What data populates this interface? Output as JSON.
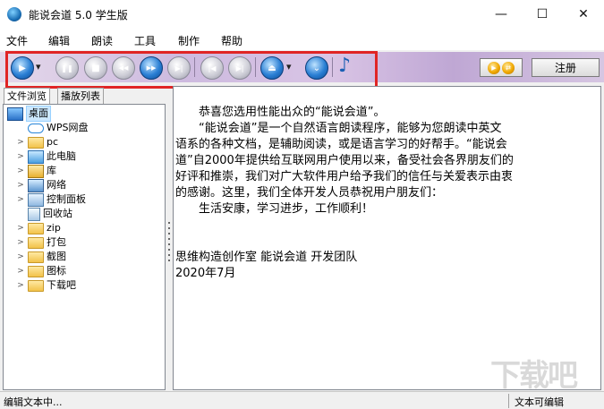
{
  "window": {
    "title": "能说会道 5.0 学生版",
    "minimize_glyph": "—",
    "maximize_glyph": "☐",
    "close_glyph": "✕"
  },
  "menu": [
    "文件",
    "编辑",
    "朗读",
    "工具",
    "制作",
    "帮助"
  ],
  "toolbar": {
    "buttons": [
      {
        "name": "play",
        "icon": "play-icon",
        "glyph": "▶"
      },
      {
        "name": "play-dropdown",
        "icon": "dropdown-arrow-icon",
        "glyph": "▾"
      },
      {
        "name": "pause",
        "icon": "pause-icon",
        "glyph": "❚❚"
      },
      {
        "name": "stop",
        "icon": "stop-icon",
        "glyph": "■"
      },
      {
        "name": "rewind",
        "icon": "rewind-icon",
        "glyph": "◀◀"
      },
      {
        "name": "fast-forward",
        "icon": "fast-forward-icon",
        "glyph": "▶▶"
      },
      {
        "name": "skip-end",
        "icon": "skip-end-icon",
        "glyph": "▶|"
      },
      {
        "name": "prev-track",
        "icon": "prev-track-icon",
        "glyph": "|◀"
      },
      {
        "name": "next-track",
        "icon": "next-track-icon",
        "glyph": "▶|"
      },
      {
        "name": "eject",
        "icon": "eject-icon",
        "glyph": "⏏"
      },
      {
        "name": "eject-dropdown",
        "icon": "dropdown-arrow-icon",
        "glyph": "▾"
      },
      {
        "name": "down",
        "icon": "chevron-down-icon",
        "glyph": "⌄"
      },
      {
        "name": "music",
        "icon": "music-note-icon",
        "glyph": "♪"
      }
    ],
    "register_label": "注册"
  },
  "tabs": [
    "文件浏览",
    "播放列表"
  ],
  "tree": [
    {
      "label": "桌面",
      "icon": "desktop-icon",
      "expander": ""
    },
    {
      "label": "WPS网盘",
      "icon": "cloud-icon",
      "expander": ""
    },
    {
      "label": "pc",
      "icon": "user-folder-icon",
      "expander": ">"
    },
    {
      "label": "此电脑",
      "icon": "computer-icon",
      "expander": ">"
    },
    {
      "label": "库",
      "icon": "library-icon",
      "expander": ">"
    },
    {
      "label": "网络",
      "icon": "network-icon",
      "expander": ">"
    },
    {
      "label": "控制面板",
      "icon": "control-panel-icon",
      "expander": ">"
    },
    {
      "label": "回收站",
      "icon": "recycle-bin-icon",
      "expander": ""
    },
    {
      "label": "zip",
      "icon": "folder-icon",
      "expander": ">"
    },
    {
      "label": "打包",
      "icon": "folder-icon",
      "expander": ">"
    },
    {
      "label": "截图",
      "icon": "folder-icon",
      "expander": ">"
    },
    {
      "label": "图标",
      "icon": "folder-icon",
      "expander": ">"
    },
    {
      "label": "下载吧",
      "icon": "folder-icon",
      "expander": ">"
    }
  ],
  "document": {
    "lines": [
      "　　恭喜您选用性能出众的“能说会道”。",
      "　　“能说会道”是一个自然语言朗读程序，能够为您朗读中英文",
      "语系的各种文档，是辅助阅读，或是语言学习的好帮手。“能说会",
      "道”自2000年提供给互联网用户使用以来，备受社会各界朋友们的",
      "好评和推崇，我们对广大软件用户给予我们的信任与关爱表示由衷",
      "的感谢。这里，我们全体开发人员恭祝用户朋友们：",
      "　　生活安康，学习进步，工作顺利！",
      "",
      "",
      "思维构造创作室 能说会道 开发团队",
      "2020年7月"
    ]
  },
  "status": {
    "left": "编辑文本中...",
    "right": "文本可编辑"
  },
  "watermark": "下载吧"
}
